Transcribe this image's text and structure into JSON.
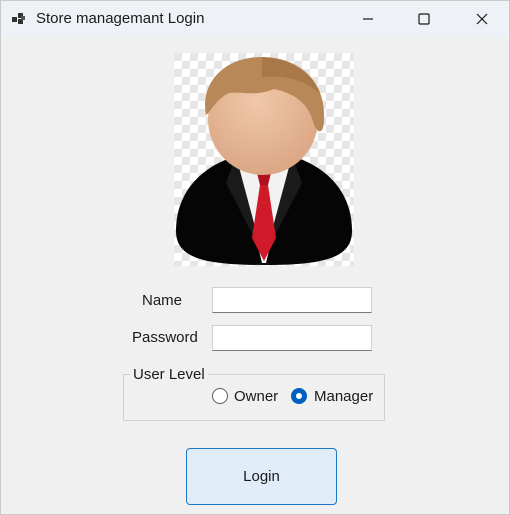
{
  "window": {
    "title": "Store managemant Login",
    "icon": "app-window-icon"
  },
  "avatar": {
    "icon": "user-avatar-icon"
  },
  "form": {
    "name_label": "Name",
    "name_value": "",
    "password_label": "Password",
    "password_value": ""
  },
  "user_level": {
    "title": "User Level",
    "options": [
      {
        "label": "Owner",
        "selected": false
      },
      {
        "label": "Manager",
        "selected": true
      }
    ]
  },
  "login_button": {
    "label": "Login"
  },
  "colors": {
    "accent": "#0060c0",
    "button_border": "#1b78c6",
    "button_bg": "#e0ecf8",
    "background": "#f0f0f0"
  }
}
